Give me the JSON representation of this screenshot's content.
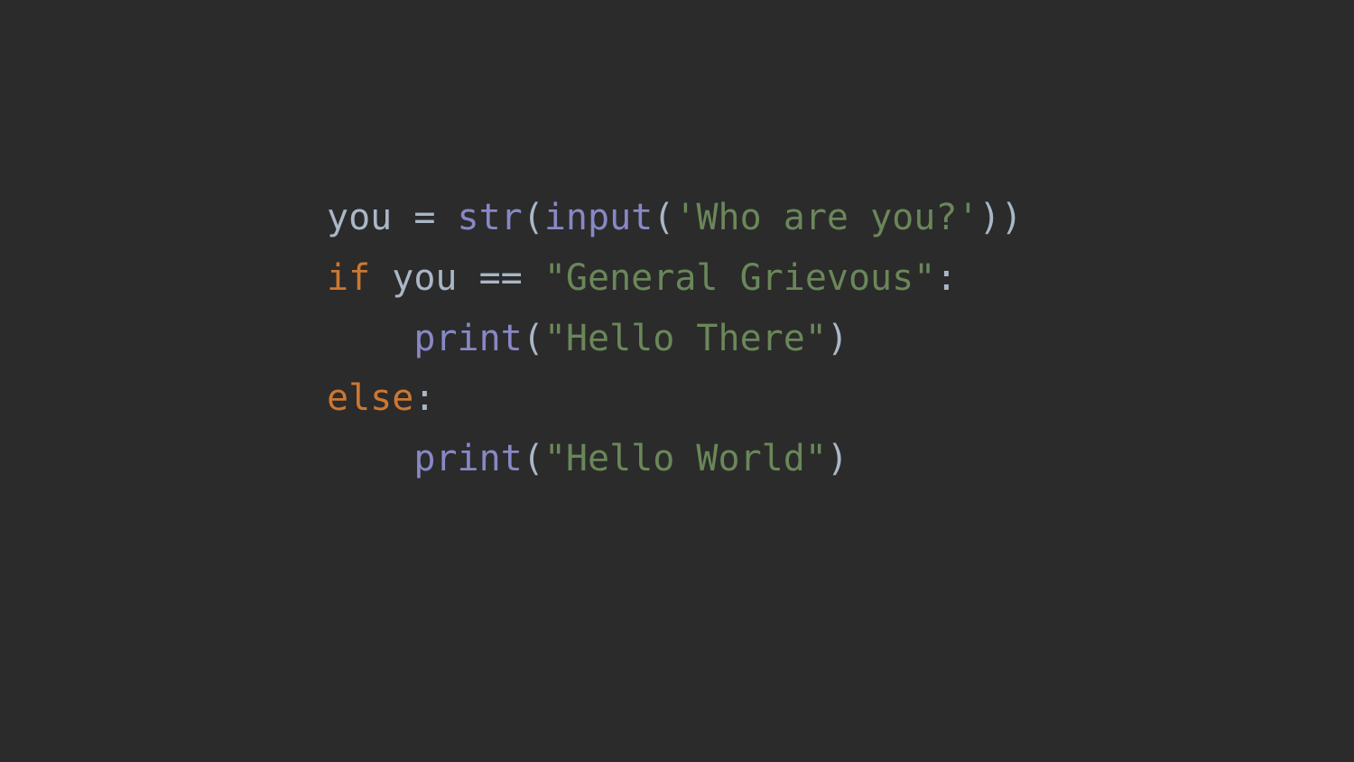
{
  "editor": {
    "colors": {
      "background": "#2b2b2b",
      "identifier": "#a9b7c6",
      "keyword": "#cc7832",
      "builtin": "#8888c6",
      "string": "#6a8759"
    },
    "lines": [
      [
        {
          "text": "you",
          "kind": "identifier"
        },
        {
          "text": " = ",
          "kind": "identifier"
        },
        {
          "text": "str",
          "kind": "builtin"
        },
        {
          "text": "(",
          "kind": "identifier"
        },
        {
          "text": "input",
          "kind": "builtin"
        },
        {
          "text": "(",
          "kind": "identifier"
        },
        {
          "text": "'Who are you?'",
          "kind": "string"
        },
        {
          "text": "))",
          "kind": "identifier"
        }
      ],
      [
        {
          "text": "if",
          "kind": "keyword"
        },
        {
          "text": " you == ",
          "kind": "identifier"
        },
        {
          "text": "\"General Grievous\"",
          "kind": "string"
        },
        {
          "text": ":",
          "kind": "identifier"
        }
      ],
      [
        {
          "text": "    ",
          "kind": "identifier"
        },
        {
          "text": "print",
          "kind": "builtin"
        },
        {
          "text": "(",
          "kind": "identifier"
        },
        {
          "text": "\"Hello There\"",
          "kind": "string"
        },
        {
          "text": ")",
          "kind": "identifier"
        }
      ],
      [
        {
          "text": "else",
          "kind": "keyword"
        },
        {
          "text": ":",
          "kind": "identifier"
        }
      ],
      [
        {
          "text": "    ",
          "kind": "identifier"
        },
        {
          "text": "print",
          "kind": "builtin"
        },
        {
          "text": "(",
          "kind": "identifier"
        },
        {
          "text": "\"Hello World\"",
          "kind": "string"
        },
        {
          "text": ")",
          "kind": "identifier"
        }
      ]
    ]
  }
}
